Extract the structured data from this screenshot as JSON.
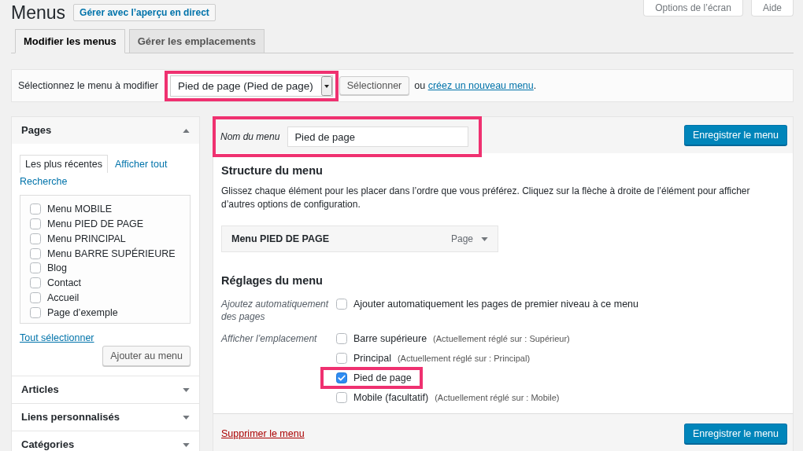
{
  "header": {
    "title": "Menus",
    "live_preview_button": "Gérer avec l’aperçu en direct",
    "screen_options_button": "Options de l’écran",
    "help_button": "Aide"
  },
  "tabs": [
    {
      "label": "Modifier les menus",
      "selected": true
    },
    {
      "label": "Gérer les emplacements",
      "selected": false
    }
  ],
  "menu_picker": {
    "label": "Sélectionnez le menu à modifier",
    "select": {
      "value": "Pied de page (Pied de page)",
      "highlighted": true
    },
    "button": "Sélectionner",
    "create_text": {
      "before": "ou",
      "link": "créez un nouveau menu",
      "after": "."
    }
  },
  "sidebar": {
    "panels": [
      {
        "title": "Pages",
        "expanded": true,
        "tabs": [
          {
            "label": "Les plus récentes",
            "selected": true
          },
          {
            "label": "Afficher tout",
            "selected": false
          },
          {
            "label": "Recherche",
            "selected": false
          }
        ],
        "items": [
          {
            "label": "Menu MOBILE",
            "checked": false
          },
          {
            "label": "Menu PIED DE PAGE",
            "checked": false
          },
          {
            "label": "Menu PRINCIPAL",
            "checked": false
          },
          {
            "label": "Menu BARRE SUPÉRIEURE",
            "checked": false
          },
          {
            "label": "Blog",
            "checked": false
          },
          {
            "label": "Contact",
            "checked": false
          },
          {
            "label": "Accueil",
            "checked": false
          },
          {
            "label": "Page d’exemple",
            "checked": false
          }
        ],
        "select_all_link": "Tout sélectionner",
        "add_button": "Ajouter au menu"
      },
      {
        "title": "Articles",
        "expanded": false
      },
      {
        "title": "Liens personnalisés",
        "expanded": false
      },
      {
        "title": "Catégories",
        "expanded": false
      }
    ]
  },
  "editor": {
    "menu_name": {
      "label": "Nom du menu",
      "value": "Pied de page",
      "highlighted": true
    },
    "save_button": "Enregistrer le menu",
    "structure": {
      "title": "Structure du menu",
      "description": "Glissez chaque élément pour les placer dans l’ordre que vous préférez. Cliquez sur la flèche à droite de l’élément pour afficher d’autres options de configuration.",
      "items": [
        {
          "title": "Menu PIED DE PAGE",
          "type": "Page"
        }
      ]
    },
    "settings": {
      "title": "Réglages du menu",
      "auto_add": {
        "label": "Ajoutez automatiquement des pages",
        "option": "Ajouter automatiquement les pages de premier niveau à ce menu",
        "checked": false
      },
      "locations": {
        "label": "Afficher l’emplacement",
        "items": [
          {
            "name": "Barre supérieure",
            "note": "(Actuellement réglé sur : Supérieur)",
            "checked": false,
            "highlighted": false
          },
          {
            "name": "Principal",
            "note": "(Actuellement réglé sur : Principal)",
            "checked": false,
            "highlighted": false
          },
          {
            "name": "Pied de page",
            "checked": true,
            "highlighted": true
          },
          {
            "name": "Mobile (facultatif)",
            "note": "(Actuellement réglé sur : Mobile)",
            "checked": false,
            "highlighted": false
          }
        ]
      }
    },
    "footer": {
      "delete_link": "Supprimer le menu",
      "save_button": "Enregistrer le menu"
    }
  }
}
